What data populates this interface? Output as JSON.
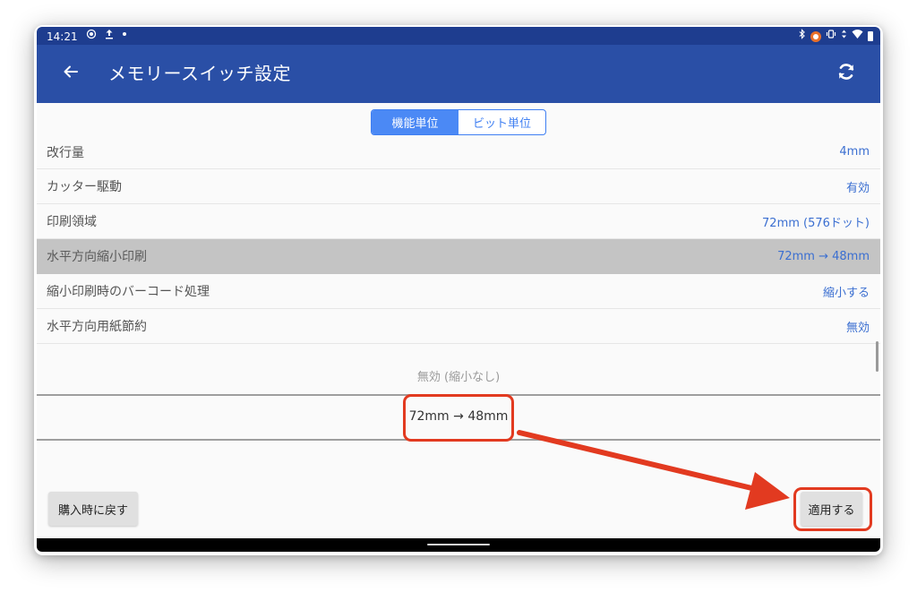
{
  "status_bar": {
    "time": "14:21",
    "left_icons": [
      "location-icon",
      "upload-icon",
      "dot-icon"
    ],
    "right_icons": [
      "bluetooth-icon",
      "record-icon",
      "vibrate-icon",
      "data-arrows-icon",
      "wifi-icon",
      "battery-icon"
    ]
  },
  "app_bar": {
    "title": "メモリースイッチ設定",
    "back_icon": "back-arrow-icon",
    "refresh_icon": "refresh-icon",
    "color": "#2a4fa6"
  },
  "segment": {
    "options": [
      "機能単位",
      "ビット単位"
    ],
    "selected_index": 0
  },
  "settings": [
    {
      "label": "改行量",
      "value": "4mm"
    },
    {
      "label": "カッター駆動",
      "value": "有効"
    },
    {
      "label": "印刷領域",
      "value": "72mm (576ドット)"
    },
    {
      "label": "水平方向縮小印刷",
      "value": "72mm → 48mm",
      "selected": true
    },
    {
      "label": "縮小印刷時のバーコード処理",
      "value": "縮小する"
    },
    {
      "label": "水平方向用紙節約",
      "value": "無効"
    }
  ],
  "picker": {
    "options": [
      "無効 (縮小なし)",
      "72mm → 48mm"
    ],
    "selected": "72mm → 48mm"
  },
  "buttons": {
    "reset": "購入時に戻す",
    "apply": "適用する"
  },
  "annotation_color": "#e23a20"
}
